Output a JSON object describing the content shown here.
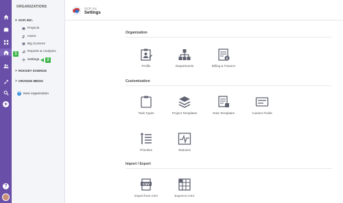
{
  "sidebar": {
    "title": "ORGANIZATIONS",
    "orgs": [
      {
        "name": "GCP, INC.",
        "chevron": "v"
      },
      {
        "name": "ROCKET SCIENCE",
        "chevron": ">"
      },
      {
        "name": "ORANGE MEDIA",
        "chevron": ">"
      }
    ],
    "items": [
      {
        "label": "Projects",
        "icon": "briefcase-icon"
      },
      {
        "label": "Users",
        "icon": "users-icon"
      },
      {
        "label": "Big Screens",
        "icon": "screen-icon"
      },
      {
        "label": "Reports & Analytics",
        "icon": "bar-chart-icon"
      },
      {
        "label": "Settings",
        "icon": "gear-icon"
      }
    ],
    "new_org_label": "New organization",
    "badges": [
      "1",
      "2"
    ]
  },
  "header": {
    "org_name": "GCP, Inc.",
    "title": "Settings"
  },
  "sections": [
    {
      "title": "Organization",
      "tiles": [
        "Profile",
        "Departments",
        "Billing & Finance"
      ]
    },
    {
      "title": "Customization",
      "tiles": [
        "Task Types",
        "Project Templates",
        "Note Templates",
        "Custom Fields",
        "Priorities",
        "Statuses"
      ]
    },
    {
      "title": "Import / Export",
      "tiles": [
        "Import from CSV",
        "Export to CSV"
      ]
    }
  ],
  "colors": {
    "rail": "#6a4fa8",
    "accent_green": "#3fb54a",
    "icon_gray": "#5f6270"
  },
  "rail": {
    "help_glyph": "?"
  }
}
